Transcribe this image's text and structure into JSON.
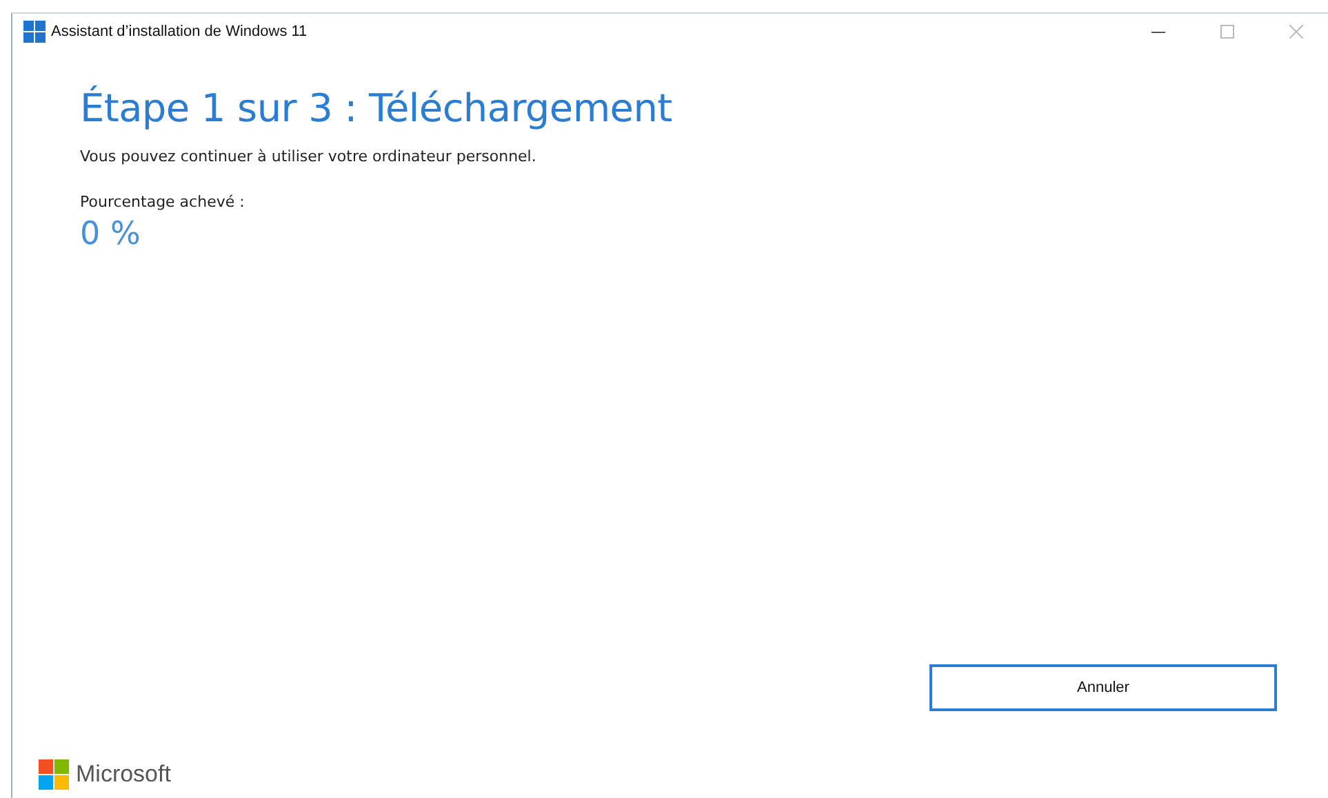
{
  "window": {
    "title": "Assistant d’installation de Windows 11"
  },
  "heading": "Étape 1 sur 3 : Téléchargement",
  "message": "Vous pouvez continuer à utiliser votre ordinateur personnel.",
  "progress": {
    "label": "Pourcentage achevé :",
    "value": "0 %"
  },
  "buttons": [
    {
      "label": "Annuler"
    }
  ],
  "brand": "Microsoft"
}
